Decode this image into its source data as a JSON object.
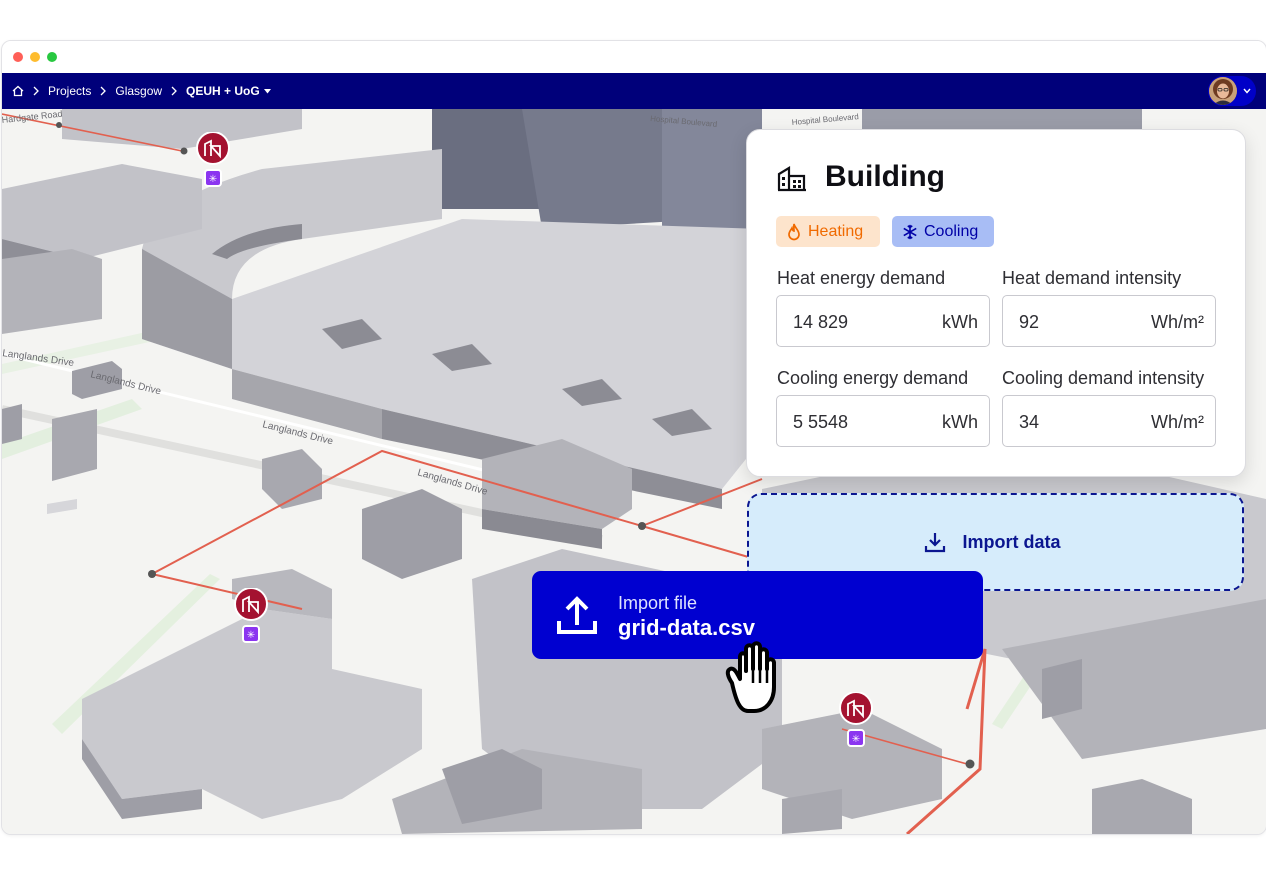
{
  "breadcrumb": {
    "home_icon": "home-icon",
    "items": [
      "Projects",
      "Glasgow"
    ],
    "current": "QEUH + UoG"
  },
  "user": {
    "avatar": "user-avatar"
  },
  "map": {
    "street_labels": [
      "Langlands Drive",
      "Langlands Drive",
      "Langlands Drive",
      "Hospital Boulevard",
      "Hospital Boulevard",
      "Hardgate Road"
    ],
    "route_color": "#e2604f",
    "marker_color": "#a41230",
    "marker_badge_color": "#8b35f0"
  },
  "panel": {
    "title": "Building",
    "icon": "building-icon",
    "chips": {
      "heating": {
        "label": "Heating",
        "icon": "flame-icon",
        "color": "#f06a00"
      },
      "cooling": {
        "label": "Cooling",
        "icon": "snowflake-icon",
        "color": "#0000a6"
      }
    },
    "fields": {
      "heat_energy": {
        "label": "Heat energy demand",
        "value": "14 829",
        "unit": "kWh"
      },
      "heat_intensity": {
        "label": "Heat demand intensity",
        "value": "92",
        "unit": "Wh/m²"
      },
      "cool_energy": {
        "label": "Cooling energy demand",
        "value": "5 5548",
        "unit": "kWh"
      },
      "cool_intensity": {
        "label": "Cooling demand intensity",
        "value": "34",
        "unit": "Wh/m²"
      }
    }
  },
  "dropzone": {
    "label": "Import data",
    "icon": "download-icon"
  },
  "import_card": {
    "label": "Import file",
    "filename": "grid-data.csv",
    "icon": "upload-icon"
  },
  "cursor": "grab-hand-cursor",
  "colors": {
    "navbar": "#00007a",
    "accent": "#0000d0"
  }
}
